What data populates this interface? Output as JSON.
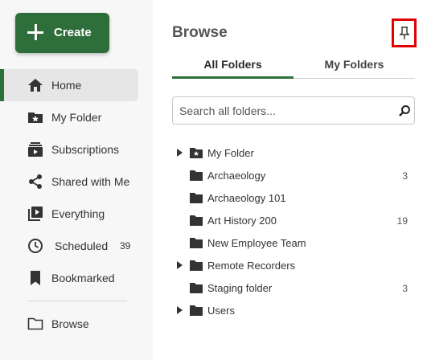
{
  "create": {
    "label": "Create"
  },
  "sidebar": {
    "items": [
      {
        "label": "Home",
        "icon": "home-icon",
        "active": true
      },
      {
        "label": "My Folder",
        "icon": "star-folder-icon"
      },
      {
        "label": "Subscriptions",
        "icon": "subscriptions-icon"
      },
      {
        "label": "Shared with Me",
        "icon": "share-icon"
      },
      {
        "label": "Everything",
        "icon": "play-library-icon"
      },
      {
        "label": "Scheduled",
        "icon": "clock-icon",
        "count": "39"
      },
      {
        "label": "Bookmarked",
        "icon": "bookmark-icon"
      },
      {
        "label": "Browse",
        "icon": "folder-outline-icon"
      }
    ]
  },
  "browse": {
    "title": "Browse",
    "pin_icon": "pin-icon",
    "tabs": [
      {
        "label": "All Folders",
        "selected": true
      },
      {
        "label": "My Folders",
        "selected": false
      }
    ],
    "search": {
      "placeholder": "Search all folders...",
      "value": ""
    },
    "folders": [
      {
        "name": "My Folder",
        "expandable": true,
        "icon": "star-folder-icon",
        "count": ""
      },
      {
        "name": "Archaeology",
        "expandable": false,
        "icon": "folder-icon",
        "count": "3"
      },
      {
        "name": "Archaeology 101",
        "expandable": false,
        "icon": "folder-icon",
        "count": ""
      },
      {
        "name": "Art History 200",
        "expandable": false,
        "icon": "folder-icon",
        "count": "19"
      },
      {
        "name": "New Employee Team",
        "expandable": false,
        "icon": "folder-icon",
        "count": ""
      },
      {
        "name": "Remote Recorders",
        "expandable": true,
        "icon": "folder-icon",
        "count": ""
      },
      {
        "name": "Staging folder",
        "expandable": false,
        "icon": "folder-icon",
        "count": "3"
      },
      {
        "name": "Users",
        "expandable": true,
        "icon": "folder-icon",
        "count": ""
      }
    ]
  },
  "colors": {
    "accent": "#2e6e3a",
    "highlight_box": "#e00000"
  }
}
